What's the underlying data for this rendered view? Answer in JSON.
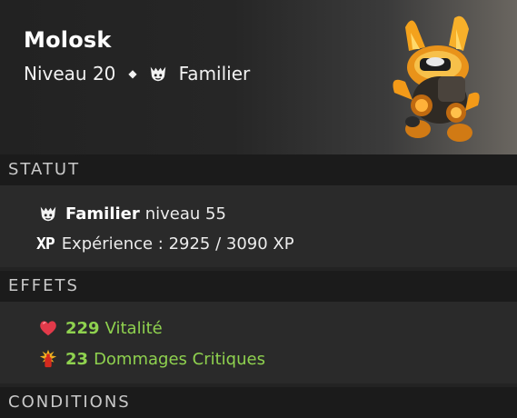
{
  "item": {
    "name": "Molosk",
    "level": "Niveau 20",
    "separator": "◆",
    "type": "Familier",
    "type_icon": "pet-icon",
    "image": "molosk-pet-image"
  },
  "sections": {
    "status": {
      "title": "STATUT",
      "pet_level_name": "Familier",
      "pet_level_text": "niveau 55",
      "pet_level_icon": "pet-icon",
      "xp_icon": "XP",
      "xp_text": "Expérience : 2925 / 3090 XP"
    },
    "effects": {
      "title": "EFFETS",
      "items": [
        {
          "value": "229",
          "label": "Vitalité",
          "icon": "heart-icon"
        },
        {
          "value": "23",
          "label": "Dommages Critiques",
          "icon": "critical-damage-icon"
        }
      ]
    },
    "conditions": {
      "title": "CONDITIONS"
    }
  },
  "colors": {
    "background": "#232323",
    "section_header": "#1b1b1b",
    "effect_green": "#8fd24f"
  }
}
